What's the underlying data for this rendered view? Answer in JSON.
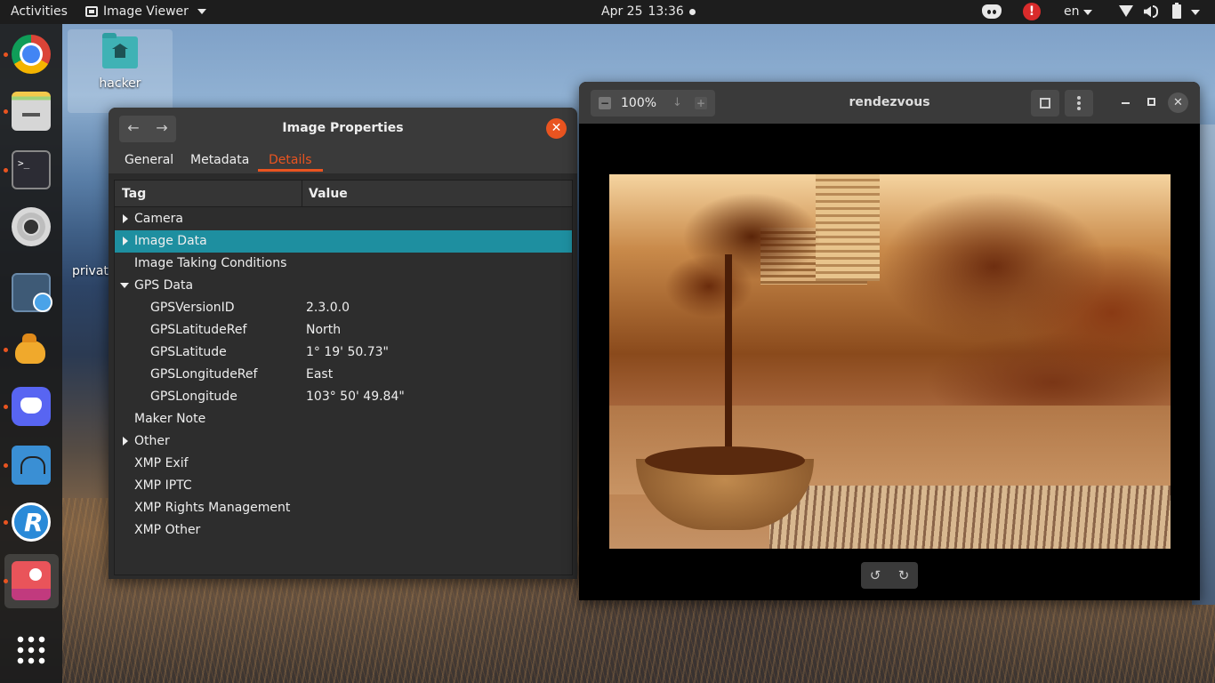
{
  "topbar": {
    "activities": "Activities",
    "app_name": "Image Viewer",
    "clock_date": "Apr 25",
    "clock_time": "13:36",
    "language": "en",
    "alert_symbol": "!"
  },
  "desktop": {
    "icons": [
      {
        "label": "hacker"
      },
      {
        "label": "privat"
      }
    ]
  },
  "properties_window": {
    "title": "Image Properties",
    "tabs": [
      "General",
      "Metadata",
      "Details"
    ],
    "active_tab": "Details",
    "columns": {
      "tag": "Tag",
      "value": "Value"
    },
    "rows": [
      {
        "label": "Camera",
        "value": "",
        "expander": "collapsed",
        "child": false
      },
      {
        "label": "Image Data",
        "value": "",
        "expander": "collapsed",
        "child": false,
        "selected": true
      },
      {
        "label": "Image Taking Conditions",
        "value": "",
        "expander": "none",
        "child": false
      },
      {
        "label": "GPS Data",
        "value": "",
        "expander": "expanded",
        "child": false
      },
      {
        "label": "GPSVersionID",
        "value": "2.3.0.0",
        "expander": "none",
        "child": true
      },
      {
        "label": "GPSLatitudeRef",
        "value": "North",
        "expander": "none",
        "child": true
      },
      {
        "label": "GPSLatitude",
        "value": "1° 19' 50.73\"",
        "expander": "none",
        "child": true
      },
      {
        "label": "GPSLongitudeRef",
        "value": "East",
        "expander": "none",
        "child": true
      },
      {
        "label": "GPSLongitude",
        "value": "103° 50' 49.84\"",
        "expander": "none",
        "child": true
      },
      {
        "label": "Maker Note",
        "value": "",
        "expander": "none",
        "child": false
      },
      {
        "label": "Other",
        "value": "",
        "expander": "collapsed",
        "child": false
      },
      {
        "label": "XMP Exif",
        "value": "",
        "expander": "none",
        "child": false
      },
      {
        "label": "XMP IPTC",
        "value": "",
        "expander": "none",
        "child": false
      },
      {
        "label": "XMP Rights Management",
        "value": "",
        "expander": "none",
        "child": false
      },
      {
        "label": "XMP Other",
        "value": "",
        "expander": "none",
        "child": false
      }
    ]
  },
  "viewer_window": {
    "title": "rendezvous",
    "zoom": "100%"
  },
  "colors": {
    "accent": "#e95420",
    "selection": "#1e8fa0"
  }
}
